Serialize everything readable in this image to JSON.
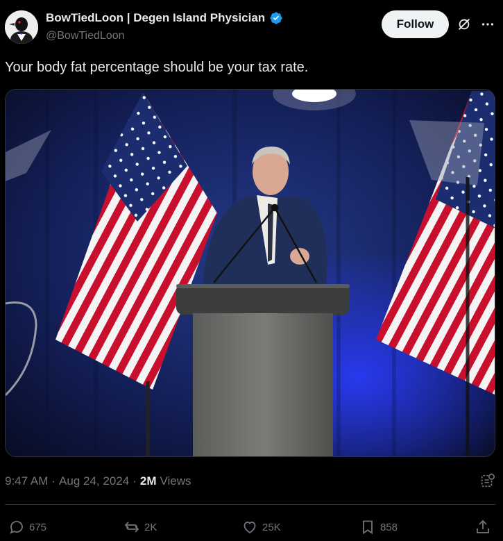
{
  "author": {
    "display_name": "BowTiedLoon | Degen Island Physician",
    "handle": "@BowTiedLoon",
    "verified": true
  },
  "header": {
    "follow_label": "Follow",
    "grok_icon": "grok-icon",
    "more_icon": "more-icon"
  },
  "tweet": {
    "text": "Your body fat percentage should be your tax rate.",
    "time": "9:47 AM",
    "date": "Aug 24, 2024",
    "views_count": "2M",
    "views_label": "Views",
    "separator": "·"
  },
  "actions": {
    "replies": "675",
    "reposts": "2K",
    "likes": "25K",
    "bookmarks": "858"
  },
  "colors": {
    "background": "#000000",
    "verified_blue": "#1d9bf0",
    "muted_text": "#71767b",
    "primary_text": "#e7e9ea"
  }
}
